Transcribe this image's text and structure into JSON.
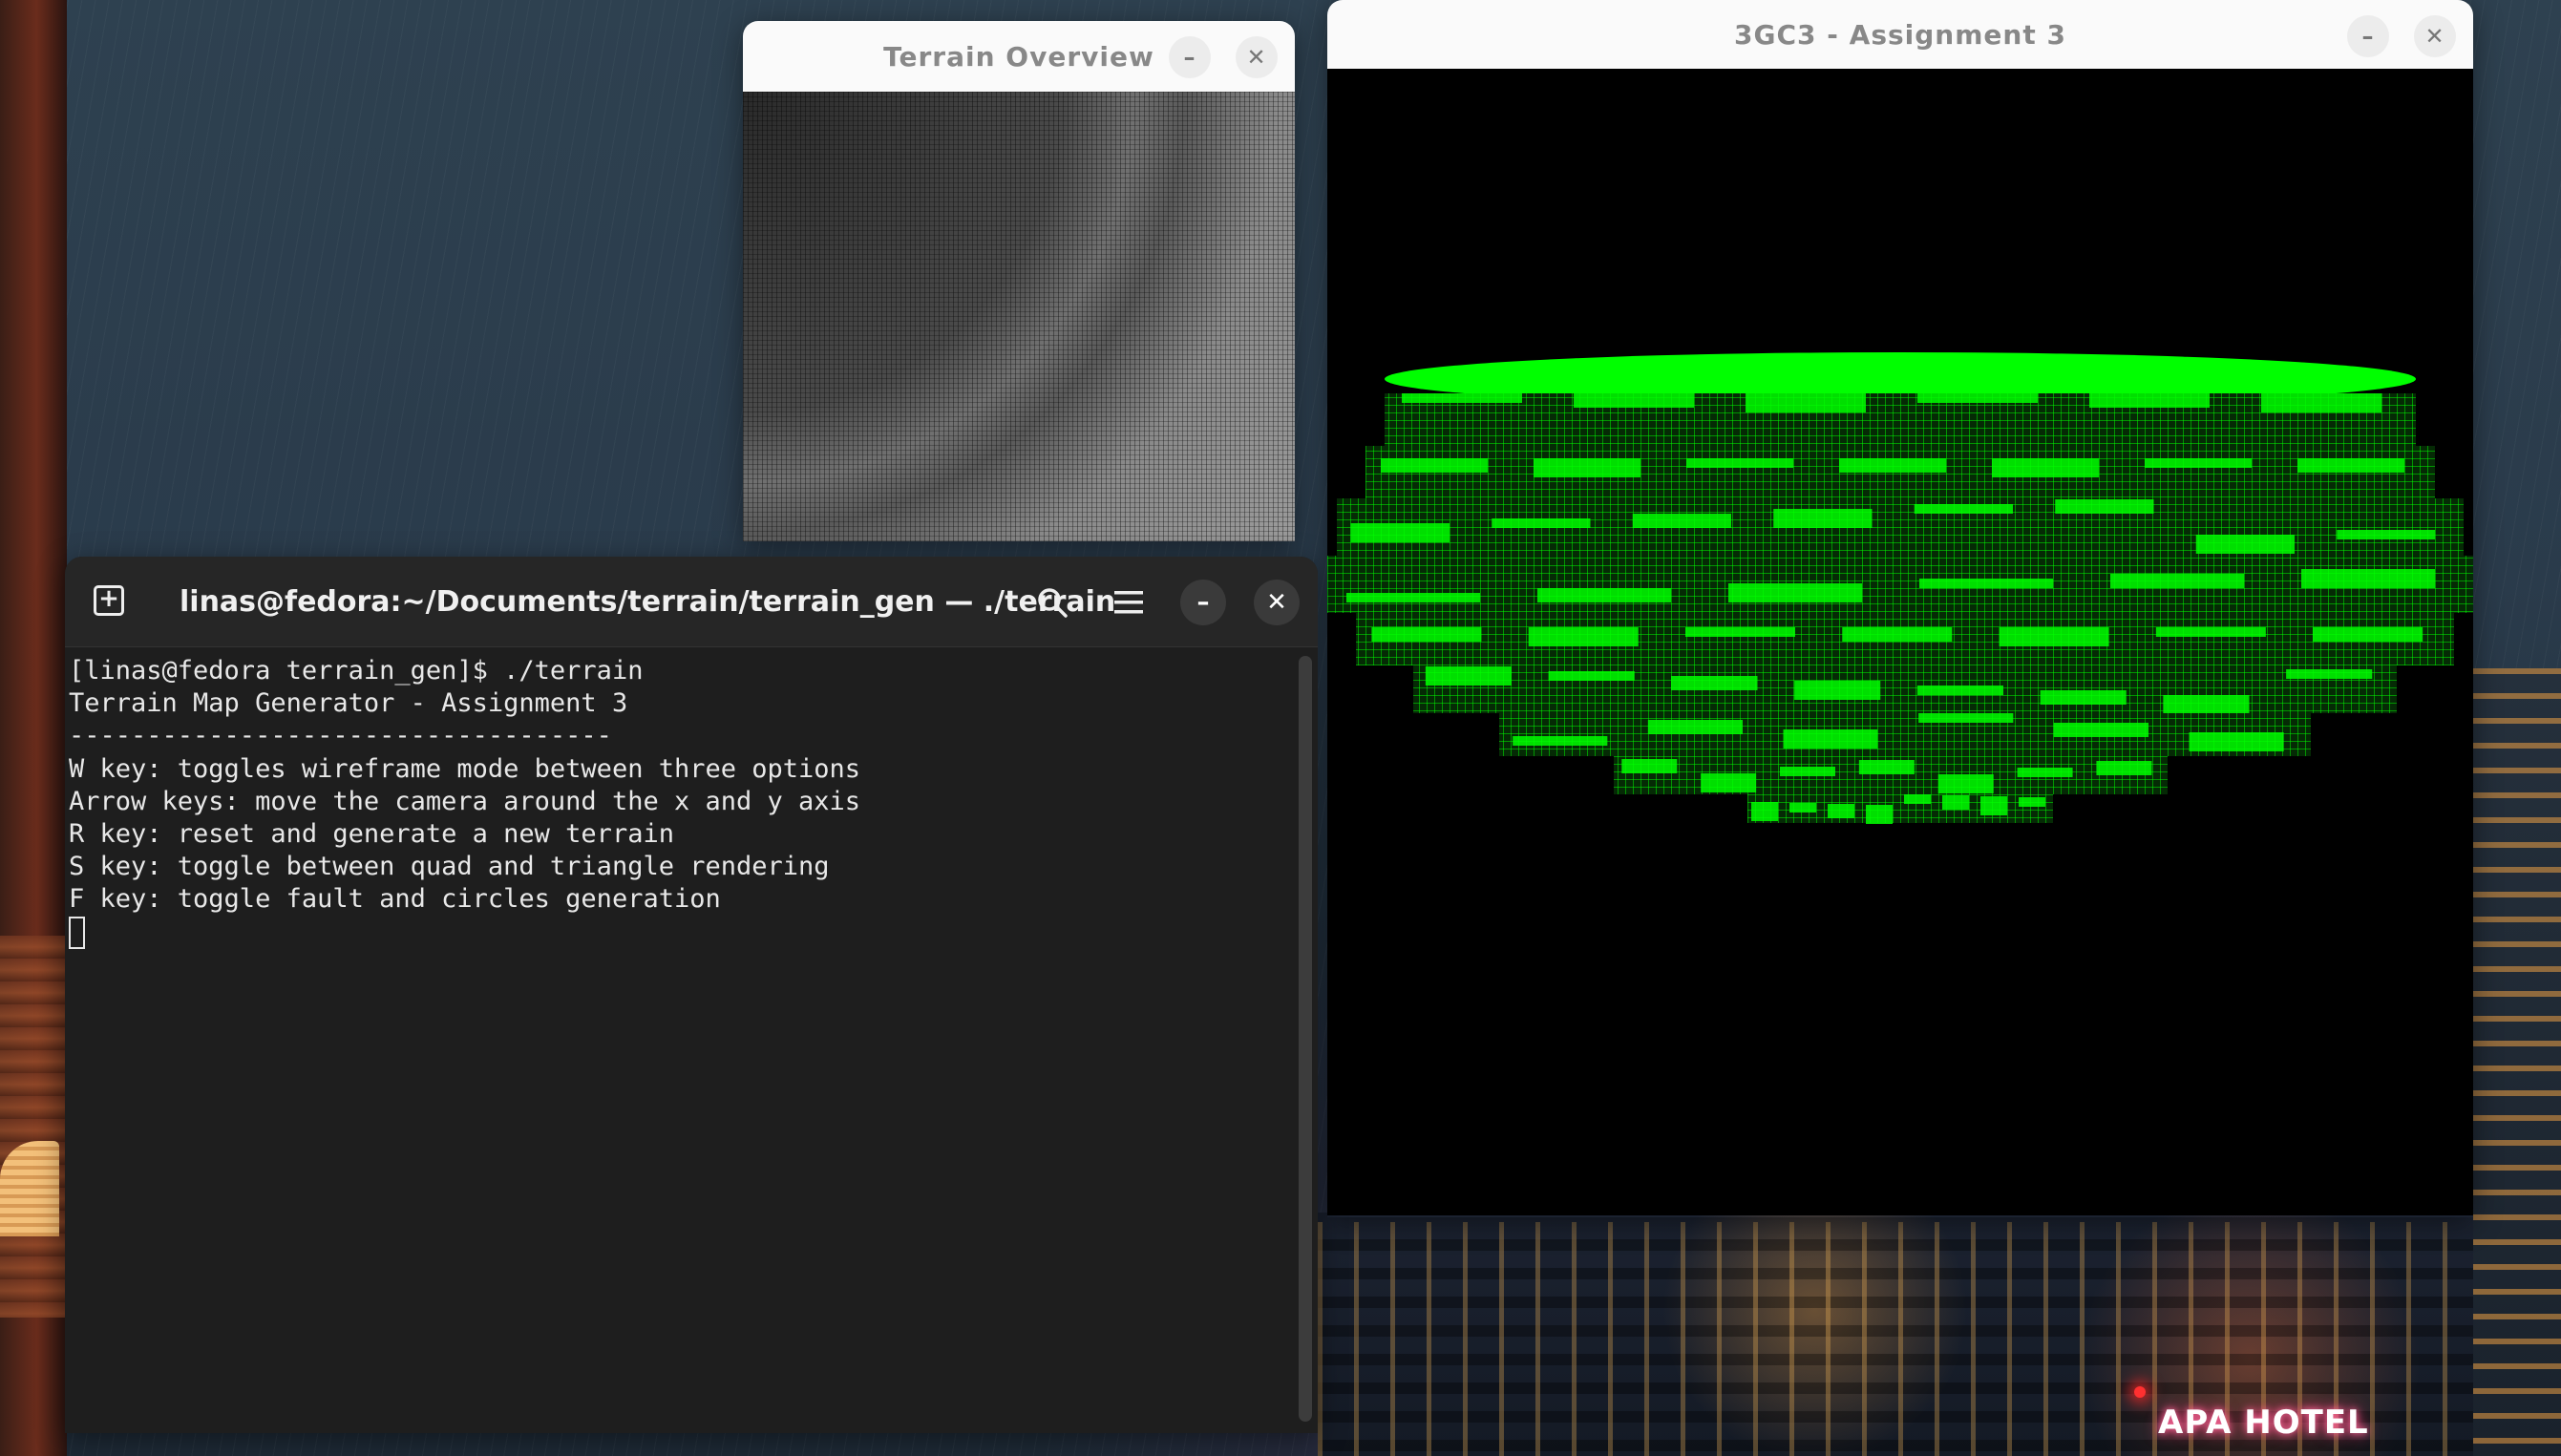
{
  "overview_window": {
    "title": "Terrain Overview",
    "minimize_glyph": "–",
    "close_glyph": "✕"
  },
  "main_window": {
    "title": "3GC3 - Assignment 3",
    "minimize_glyph": "–",
    "close_glyph": "✕",
    "render_color": "#00ff00"
  },
  "terminal": {
    "title": "linas@fedora:~/Documents/terrain/terrain_gen — ./terrain",
    "new_tab_glyph": "+",
    "minimize_glyph": "–",
    "close_glyph": "✕",
    "lines": [
      "[linas@fedora terrain_gen]$ ./terrain",
      "Terrain Map Generator - Assignment 3",
      "-----------------------------------",
      "W key: toggles wireframe mode between three options",
      "Arrow keys: move the camera around the x and y axis",
      "R key: reset and generate a new terrain",
      "S key: toggle between quad and triangle rendering",
      "F key: toggle fault and circles generation"
    ]
  },
  "wallpaper": {
    "sign_text": "APA HOTEL"
  }
}
